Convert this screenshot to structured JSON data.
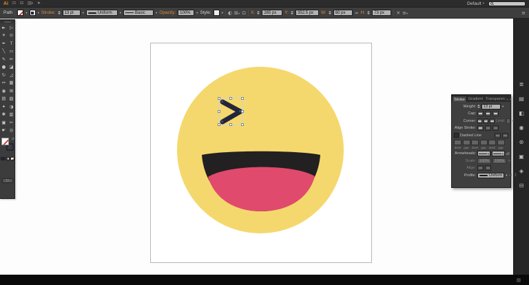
{
  "app_bar": {
    "logo": "Ai",
    "workspace": "Default"
  },
  "control_bar": {
    "selection_type": "Path",
    "stroke_label": "Stroke:",
    "stroke_weight": "13 pt",
    "width_profile": "Uniform",
    "brush_definition": "Basic",
    "opacity_label": "Opacity:",
    "opacity_value": "100%",
    "style_label": "Style:",
    "x_label": "X:",
    "x_value": "285 px",
    "y_label": "Y:",
    "y_value": "352.5 px",
    "w_label": "W:",
    "w_value": "60 px",
    "h_label": "H:",
    "h_value": "73 px"
  },
  "tools": [
    {
      "name": "selection-tool",
      "glyph": "►"
    },
    {
      "name": "direct-selection-tool",
      "glyph": "▷"
    },
    {
      "name": "magic-wand-tool",
      "glyph": "✶"
    },
    {
      "name": "lasso-tool",
      "glyph": "⊙"
    },
    {
      "name": "pen-tool",
      "glyph": "✒"
    },
    {
      "name": "type-tool",
      "glyph": "T"
    },
    {
      "name": "line-segment-tool",
      "glyph": "╲"
    },
    {
      "name": "rectangle-tool",
      "glyph": "▭"
    },
    {
      "name": "paintbrush-tool",
      "glyph": "✎"
    },
    {
      "name": "pencil-tool",
      "glyph": "✏"
    },
    {
      "name": "blob-brush-tool",
      "glyph": "●"
    },
    {
      "name": "eraser-tool",
      "glyph": "◪"
    },
    {
      "name": "rotate-tool",
      "glyph": "↻"
    },
    {
      "name": "scale-tool",
      "glyph": "◿"
    },
    {
      "name": "width-tool",
      "glyph": "↔"
    },
    {
      "name": "free-transform-tool",
      "glyph": "▦"
    },
    {
      "name": "shape-builder-tool",
      "glyph": "◉"
    },
    {
      "name": "perspective-grid-tool",
      "glyph": "⊞"
    },
    {
      "name": "mesh-tool",
      "glyph": "▤"
    },
    {
      "name": "gradient-tool",
      "glyph": "▧"
    },
    {
      "name": "eyedropper-tool",
      "glyph": "✦"
    },
    {
      "name": "blend-tool",
      "glyph": "◑"
    },
    {
      "name": "symbol-sprayer-tool",
      "glyph": "✱"
    },
    {
      "name": "column-graph-tool",
      "glyph": "▥"
    },
    {
      "name": "artboard-tool",
      "glyph": "▣"
    },
    {
      "name": "slice-tool",
      "glyph": "✂"
    },
    {
      "name": "hand-tool",
      "glyph": "☛"
    },
    {
      "name": "zoom-tool",
      "glyph": "◎"
    }
  ],
  "stroke_panel": {
    "tabs": [
      "Stroke",
      "Gradient",
      "Transparen"
    ],
    "weight_label": "Weight:",
    "weight_value": "13 pt",
    "cap_label": "Cap:",
    "corner_label": "Corner:",
    "limit_label": "Limit:",
    "limit_unit": "x",
    "align_stroke_label": "Align Stroke:",
    "dashed_line_label": "Dashed Line",
    "dash_field_labels": [
      "dash",
      "gap",
      "dash",
      "gap",
      "dash",
      "gap"
    ],
    "arrowheads_label": "Arrowheads:",
    "scale_label": "Scale:",
    "scale_left": "100%",
    "scale_right": "100%",
    "align_label": "Align:",
    "profile_label": "Profile:",
    "profile_value": "Uniform"
  },
  "dock_icons": [
    {
      "name": "color-icon",
      "glyph": "≣"
    },
    {
      "name": "color-guide-icon",
      "glyph": "▤"
    },
    {
      "name": "swatches-icon",
      "glyph": "◧"
    },
    {
      "name": "brushes-icon",
      "glyph": "◉"
    },
    {
      "name": "symbols-icon",
      "glyph": "⊛"
    },
    {
      "name": "appearance-icon",
      "glyph": "▣"
    },
    {
      "name": "graphic-styles-icon",
      "glyph": "◈"
    },
    {
      "name": "layers-icon",
      "glyph": "⊟"
    }
  ],
  "canvas": {
    "face_color": "#F5D86D",
    "mouth_color": "#232021",
    "tongue_color": "#E04A6C",
    "eye_stroke_color": "#23263A"
  }
}
